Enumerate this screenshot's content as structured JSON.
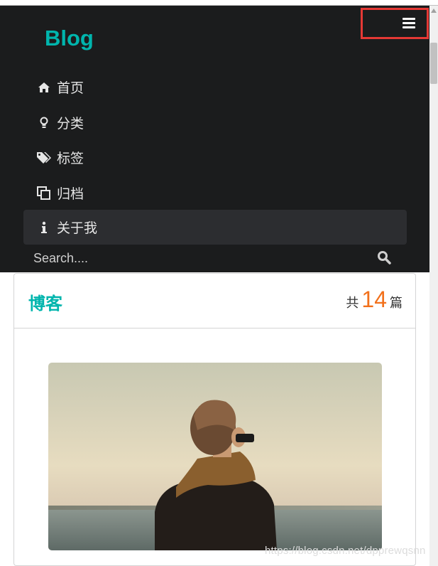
{
  "navbar": {
    "brand": "Blog",
    "items": [
      {
        "label": "首页",
        "icon": "home-icon",
        "active": false
      },
      {
        "label": "分类",
        "icon": "lightbulb-icon",
        "active": false
      },
      {
        "label": "标签",
        "icon": "tags-icon",
        "active": false
      },
      {
        "label": "归档",
        "icon": "clone-icon",
        "active": false
      },
      {
        "label": "关于我",
        "icon": "info-icon",
        "active": true
      }
    ],
    "search_placeholder": "Search....",
    "menu_icon": "hamburger-menu-icon",
    "highlight_color": "#e53935"
  },
  "card": {
    "title": "博客",
    "count_prefix": "共",
    "count_value": "14",
    "count_suffix": "篇"
  },
  "colors": {
    "teal": "#00b5ad",
    "orange": "#f2711c",
    "dark": "#1b1c1d"
  },
  "watermark": "https://blog.csdn.net/dpprewqsnn"
}
